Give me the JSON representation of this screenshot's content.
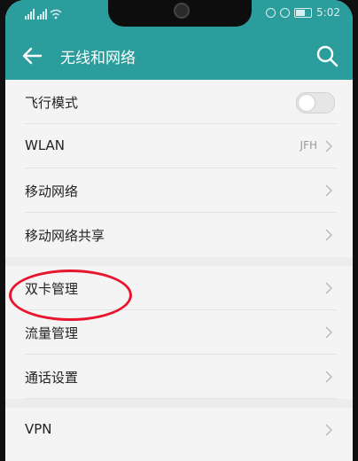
{
  "status_bar": {
    "time": "5:02"
  },
  "header": {
    "title": "无线和网络"
  },
  "rows": [
    {
      "label": "飞行模式",
      "toggle": false
    },
    {
      "label": "WLAN",
      "value": "JFH"
    },
    {
      "label": "移动网络"
    },
    {
      "label": "移动网络共享"
    },
    {
      "label": "双卡管理"
    },
    {
      "label": "流量管理"
    },
    {
      "label": "通话设置"
    },
    {
      "label": "VPN"
    }
  ],
  "colors": {
    "header": "#2a9d9c",
    "annotation": "#e8152f"
  }
}
